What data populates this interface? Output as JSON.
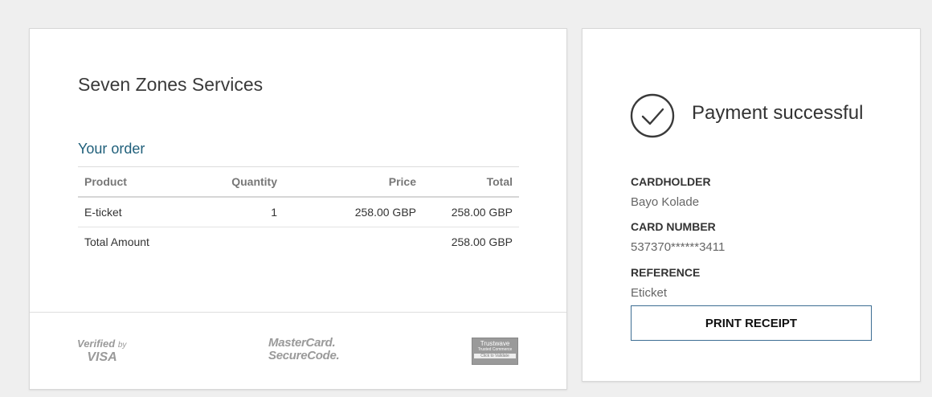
{
  "order": {
    "merchant": "Seven Zones Services",
    "heading": "Your order",
    "columns": [
      "Product",
      "Quantity",
      "Price",
      "Total"
    ],
    "rows": [
      {
        "product": "E-ticket",
        "quantity": "1",
        "price": "258.00 GBP",
        "total": "258.00 GBP"
      }
    ],
    "total_label": "Total Amount",
    "total_amount": "258.00 GBP"
  },
  "badges": {
    "verified_line1": "Verified",
    "verified_by": "by",
    "verified_line2": "VISA",
    "mastercard_line1": "MasterCard.",
    "mastercard_line2": "SecureCode.",
    "trustwave_line1": "Trustwave",
    "trustwave_line2": "Trusted Commerce",
    "trustwave_line3": "Click to Validate"
  },
  "payment": {
    "status": "Payment successful",
    "status_icon": "check-circle-icon",
    "cardholder_label": "CARDHOLDER",
    "cardholder_value": "Bayo Kolade",
    "card_number_label": "CARD NUMBER",
    "card_number_value": "537370******3411",
    "reference_label": "REFERENCE",
    "reference_value": "Eticket",
    "print_button": "PRINT RECEIPT"
  },
  "colors": {
    "accent": "#1f5f7a",
    "button_border": "#3d6d93"
  }
}
